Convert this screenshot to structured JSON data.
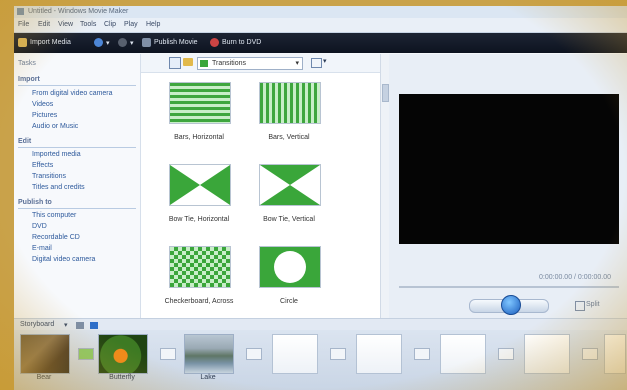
{
  "window": {
    "title": "Untitled - Windows Movie Maker",
    "icon": "film-icon"
  },
  "menu": [
    "File",
    "Edit",
    "View",
    "Tools",
    "Clip",
    "Play",
    "Help"
  ],
  "toolbar": {
    "import_media": "Import Media",
    "undo_icon": "undo-icon",
    "redo_icon": "redo-icon",
    "publish_movie": "Publish Movie",
    "burn_dvd": "Burn to DVD"
  },
  "tasks": {
    "header": "Tasks",
    "sections": [
      {
        "title": "Import",
        "items": [
          "From digital video camera",
          "Videos",
          "Pictures",
          "Audio or Music"
        ]
      },
      {
        "title": "Edit",
        "items": [
          "Imported media",
          "Effects",
          "Transitions",
          "Titles and credits"
        ]
      },
      {
        "title": "Publish to",
        "items": [
          "This computer",
          "DVD",
          "Recordable CD",
          "E-mail",
          "Digital video camera"
        ]
      }
    ]
  },
  "collection": {
    "dropdown_value": "Transitions",
    "items": [
      {
        "label": "Bars, Horizontal",
        "pattern": "hbars"
      },
      {
        "label": "Bars, Vertical",
        "pattern": "vbars"
      },
      {
        "label": "Bow Tie, Horizontal",
        "pattern": "bowtie-h"
      },
      {
        "label": "Bow Tie, Vertical",
        "pattern": "bowtie-v"
      },
      {
        "label": "Checkerboard, Across",
        "pattern": "checker"
      },
      {
        "label": "Circle",
        "pattern": "circle"
      }
    ]
  },
  "preview": {
    "timecode": "0:00:00.00 / 0:00:00.00",
    "split_label": "Split",
    "play_icon": "play-icon"
  },
  "storyboard": {
    "view_label": "Storyboard",
    "clips": [
      {
        "label": "Bear",
        "image": "bear"
      },
      {
        "label": "Butterfly",
        "image": "butterfly"
      },
      {
        "label": "Lake",
        "image": "lake"
      }
    ],
    "empty_slots": 5
  },
  "colors": {
    "accent_green": "#3aa63a",
    "toolbar_dark": "#141a27",
    "preview_screen": "#050505"
  }
}
